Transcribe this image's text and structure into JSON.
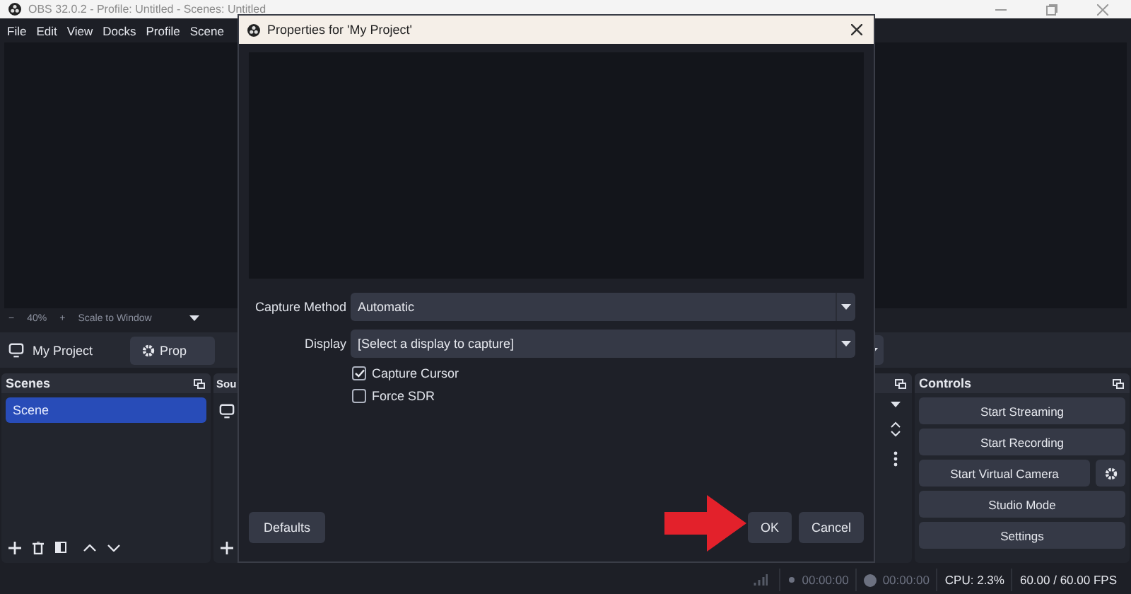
{
  "window": {
    "title": "OBS 32.0.2 - Profile: Untitled - Scenes: Untitled"
  },
  "menu": [
    "File",
    "Edit",
    "View",
    "Docks",
    "Profile",
    "Scene"
  ],
  "preview_bar": {
    "minus": "−",
    "zoom": "40%",
    "plus": "+",
    "scale": "Scale to Window"
  },
  "source_toolbar": {
    "source": "My Project",
    "properties_button": "Prop"
  },
  "scenes": {
    "title": "Scenes",
    "items": [
      {
        "label": "Scene",
        "selected": true
      }
    ]
  },
  "sources": {
    "title": "Sou"
  },
  "controls": {
    "title": "Controls",
    "buttons": [
      {
        "label": "Start Streaming",
        "kind": "plain"
      },
      {
        "label": "Start Recording",
        "kind": "plain"
      },
      {
        "label": "Start Virtual Camera",
        "kind": "with-settings"
      },
      {
        "label": "Studio Mode",
        "kind": "plain"
      },
      {
        "label": "Settings",
        "kind": "plain"
      }
    ]
  },
  "status": {
    "recording_time": "00:00:00",
    "streaming_time": "00:00:00",
    "cpu": "CPU: 2.3%",
    "fps": "60.00 / 60.00 FPS"
  },
  "dialog": {
    "title": "Properties for 'My Project'",
    "fields": [
      {
        "label": "Capture Method",
        "value": "Automatic"
      },
      {
        "label": "Display",
        "value": "[Select a display to capture]"
      }
    ],
    "checkboxes": [
      {
        "label": "Capture Cursor",
        "checked": true
      },
      {
        "label": "Force SDR",
        "checked": false
      }
    ],
    "defaults_button": "Defaults",
    "ok_button": "OK",
    "cancel_button": "Cancel"
  }
}
